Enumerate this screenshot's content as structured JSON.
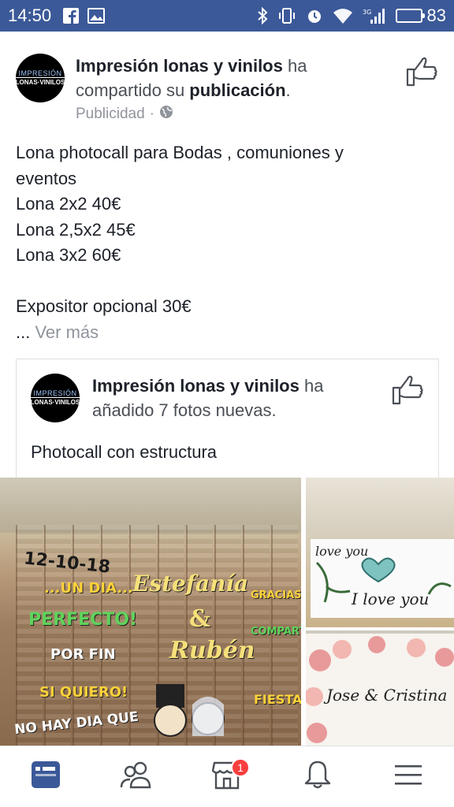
{
  "status_bar": {
    "time": "14:50",
    "battery_level": "83",
    "network_label": "3G",
    "icons": [
      "facebook-icon",
      "image-icon",
      "bluetooth-icon",
      "vibrate-icon",
      "alarm-icon",
      "wifi-icon",
      "signal-icon",
      "battery-icon"
    ]
  },
  "post": {
    "page_name": "Impresión lonas y vinilos",
    "action_prefix": " ha",
    "action_line2": "compartido su ",
    "action_bold": "publicación",
    "action_end": ".",
    "sponsored": "Publicidad",
    "dot": "·",
    "avatar_line1": "IMPRESIÓN",
    "avatar_line2": "LONAS·VINILOS",
    "body_lines": [
      "Lona photocall para Bodas , comuniones y",
      "eventos",
      "Lona 2x2 40€",
      "Lona 2,5x2 45€",
      "Lona 3x2 60€",
      "",
      "Expositor opcional 30€"
    ],
    "ellipsis": "... ",
    "see_more": "Ver más"
  },
  "shared": {
    "page_name": "Impresión lonas y vinilos",
    "action_prefix": " ha",
    "action_line2": "añadido 7 fotos nuevas.",
    "avatar_line1": "IMPRESIÓN",
    "avatar_line2": "LONAS·VINILOS",
    "caption": "Photocall con estructura"
  },
  "photos": {
    "main_texts": [
      "12-10-18",
      "...UN DIA...",
      "PERFECTO!",
      "POR FIN",
      "SI QUIERO!",
      "NO HAY DIA QUE",
      "Estefanía",
      "&",
      "Rubén",
      "GRACIAS",
      "COMPARTIR",
      "FIESTA!"
    ],
    "top_texts": [
      "love you",
      "I love you"
    ],
    "bottom_texts": [
      "Jose & Cristina"
    ]
  },
  "navbar": {
    "items": [
      "news-feed-icon",
      "friends-icon",
      "marketplace-icon",
      "notifications-icon",
      "menu-icon"
    ],
    "marketplace_badge": "1",
    "accent": "#3b5998"
  }
}
